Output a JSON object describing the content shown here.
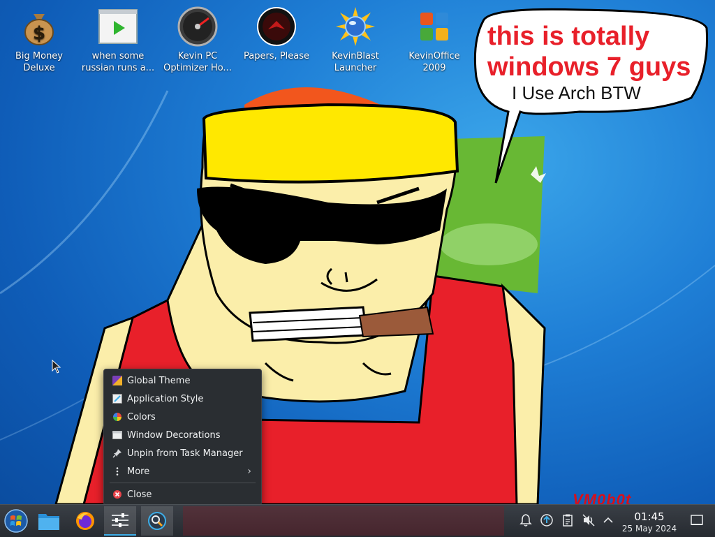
{
  "desktop": {
    "icons": [
      {
        "label_1": "Big Money",
        "label_2": "Deluxe",
        "icon": "money-bag-icon"
      },
      {
        "label_1": "when some",
        "label_2": "russian runs a...",
        "icon": "video-player-icon"
      },
      {
        "label_1": "Kevin PC",
        "label_2": "Optimizer Ho...",
        "icon": "speedometer-icon"
      },
      {
        "label_1": "Papers, Please",
        "label_2": "",
        "icon": "papers-please-icon"
      },
      {
        "label_1": "KevinBlast",
        "label_2": "Launcher",
        "icon": "sun-orb-icon"
      },
      {
        "label_1": "KevinOffice",
        "label_2": "2009",
        "icon": "office-logo-icon"
      }
    ]
  },
  "wallpaper": {
    "speech_line_1": "this is totally",
    "speech_line_2": "windows 7 guys",
    "speech_sub": "I Use Arch BTW",
    "watermark": "VM0b0t",
    "colors": {
      "bandana": "#ffe800",
      "shirt": "#e8202a",
      "skin": "#fbeeaa",
      "speech_text": "#e8202a"
    }
  },
  "context_menu": {
    "items": [
      {
        "label": "Global Theme",
        "icon": "global-theme-icon"
      },
      {
        "label": "Application Style",
        "icon": "application-style-icon"
      },
      {
        "label": "Colors",
        "icon": "colors-icon"
      },
      {
        "label": "Window Decorations",
        "icon": "window-decorations-icon"
      },
      {
        "label": "Unpin from Task Manager",
        "icon": "pin-icon"
      },
      {
        "label": "More",
        "icon": "more-vertical-icon"
      },
      {
        "label": "Close",
        "icon": "close-icon"
      }
    ]
  },
  "taskbar": {
    "apps": [
      {
        "name": "start",
        "icon": "windows-start-icon"
      },
      {
        "name": "file-manager",
        "icon": "folder-icon"
      },
      {
        "name": "firefox",
        "icon": "firefox-icon"
      },
      {
        "name": "system-settings",
        "icon": "settings-sliders-icon"
      },
      {
        "name": "discover",
        "icon": "discover-icon"
      }
    ],
    "tray": [
      "notifications-icon",
      "updates-icon",
      "clipboard-icon",
      "volume-muted-icon",
      "expand-tray-icon"
    ],
    "clock": {
      "time": "01:45",
      "date": "25 May 2024"
    },
    "accent": "#3daee9"
  }
}
